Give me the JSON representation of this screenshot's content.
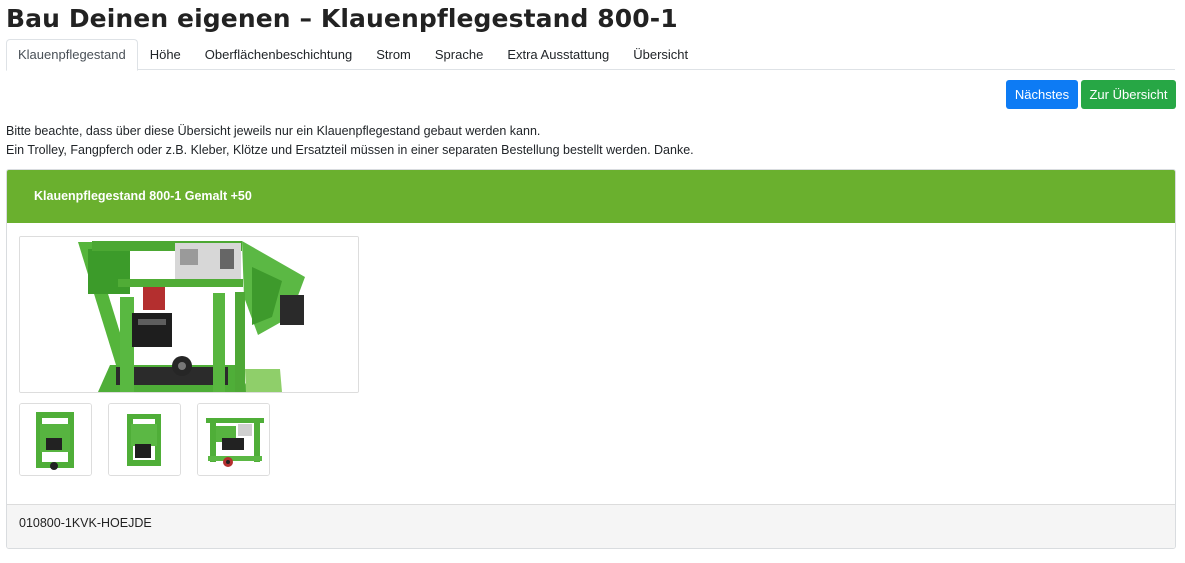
{
  "page": {
    "title": "Bau Deinen eigenen – Klauenpflegestand 800-1"
  },
  "tabs": [
    {
      "label": "Klauenpflegestand",
      "active": true
    },
    {
      "label": "Höhe",
      "active": false
    },
    {
      "label": "Oberflächenbeschichtung",
      "active": false
    },
    {
      "label": "Strom",
      "active": false
    },
    {
      "label": "Sprache",
      "active": false
    },
    {
      "label": "Extra Ausstattung",
      "active": false
    },
    {
      "label": "Übersicht",
      "active": false
    }
  ],
  "actions": {
    "next_label": "Nächstes",
    "overview_label": "Zur Übersicht"
  },
  "notice": {
    "line1": "Bitte beachte, dass über diese Übersicht jeweils nur ein Klauenpflegestand gebaut werden kann.",
    "line2": "Ein Trolley, Fangpferch oder z.B. Kleber, Klötze und Ersatzteil müssen in einer separaten Bestellung bestellt werden. Danke."
  },
  "product": {
    "header": "Klauenpflegestand 800-1 Gemalt +50",
    "sku": "010800-1KVK-HOEJDE"
  },
  "colors": {
    "header_green": "#6ab02e",
    "machine_green": "#56b43c",
    "next_blue": "#0d7bf4",
    "overview_green": "#27a745"
  }
}
